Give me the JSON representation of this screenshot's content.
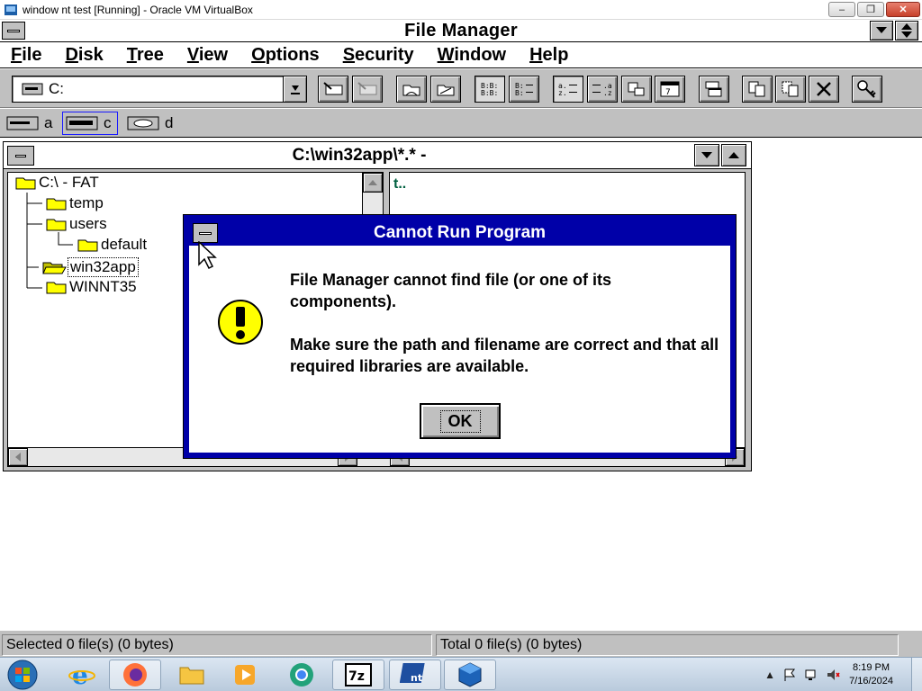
{
  "host": {
    "title": "window nt test [Running] - Oracle VM VirtualBox",
    "minimize": "‒",
    "restore": "❐",
    "close": "✕"
  },
  "app": {
    "title": "File Manager"
  },
  "menubar": {
    "items": [
      {
        "first": "F",
        "rest": "ile"
      },
      {
        "first": "D",
        "rest": "isk"
      },
      {
        "first": "T",
        "rest": "ree"
      },
      {
        "first": "V",
        "rest": "iew"
      },
      {
        "first": "O",
        "rest": "ptions"
      },
      {
        "first": "S",
        "rest": "ecurity"
      },
      {
        "first": "W",
        "rest": "indow"
      },
      {
        "first": "H",
        "rest": "elp"
      }
    ]
  },
  "toolbar": {
    "drive_value": "C:"
  },
  "drives": [
    {
      "letter": "a"
    },
    {
      "letter": "c"
    },
    {
      "letter": "d"
    }
  ],
  "mdi": {
    "title": "C:\\win32app\\*.* -"
  },
  "tree": {
    "items": [
      {
        "label": "C:\\ - FAT"
      },
      {
        "label": "temp"
      },
      {
        "label": "users"
      },
      {
        "label": "default"
      },
      {
        "label": "win32app"
      },
      {
        "label": "WINNT35"
      }
    ]
  },
  "file_pane": {
    "up_entry": "t.."
  },
  "dialog": {
    "title": "Cannot Run Program",
    "line1": "File Manager cannot find file (or one of its components).",
    "line2": "Make sure the path and filename are correct and that all required libraries are available.",
    "ok_label": "OK"
  },
  "statusbar": {
    "left": "Selected 0 file(s) (0 bytes)",
    "right": "Total 0 file(s) (0 bytes)"
  },
  "taskbar": {
    "time": "8:19 PM",
    "date": "7/16/2024",
    "tray_expand": "▲",
    "apps": [
      "internet-explorer",
      "firefox",
      "file-explorer",
      "media-player",
      "chrome",
      "7-zip",
      "windows-nt",
      "virtualbox"
    ],
    "sevenzip_label": "7z",
    "nt_label": "nt"
  },
  "colors": {
    "dialog_titlebar": "#0000a8",
    "chrome_gray": "#c0c0c0",
    "warning_yellow": "#ffff00"
  }
}
